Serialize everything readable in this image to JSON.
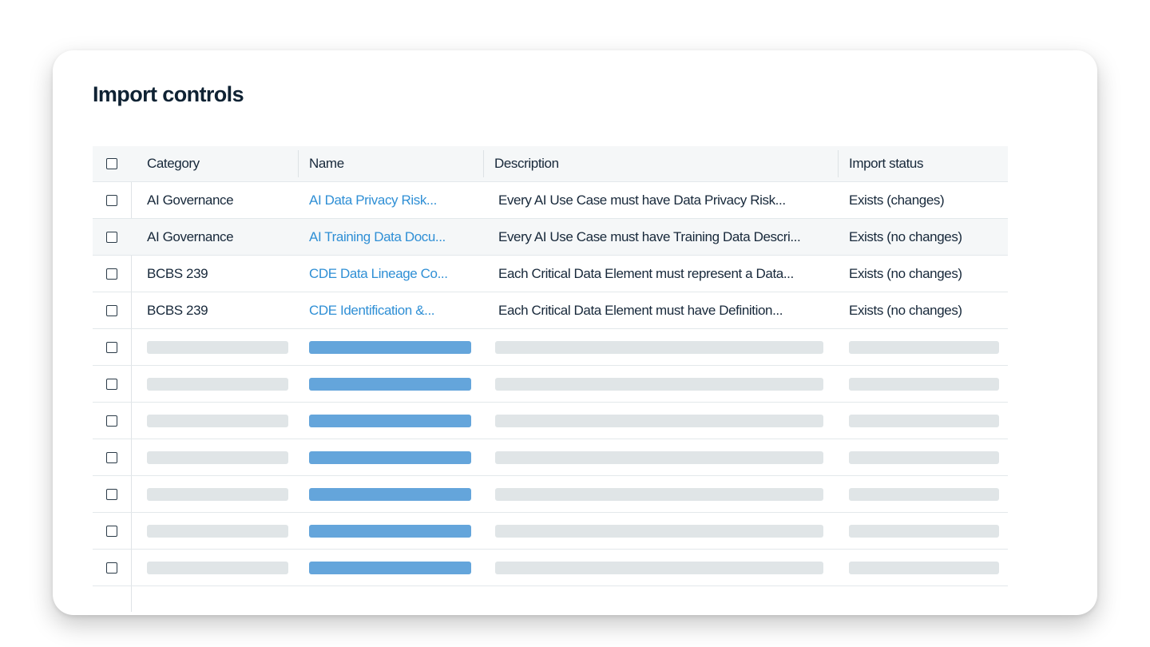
{
  "page": {
    "title": "Import controls"
  },
  "table": {
    "headers": {
      "category": "Category",
      "name": "Name",
      "description": "Description",
      "status": "Import status"
    },
    "rows": [
      {
        "category": "AI Governance",
        "name": "AI Data Privacy Risk...",
        "description": "Every AI Use Case must have Data Privacy Risk...",
        "status": "Exists (changes)"
      },
      {
        "category": "AI Governance",
        "name": "AI Training Data Docu...",
        "description": "Every AI Use Case must have Training Data Descri...",
        "status": "Exists (no changes)"
      },
      {
        "category": "BCBS 239",
        "name": "CDE Data Lineage Co...",
        "description": "Each Critical Data Element must represent a Data...",
        "status": "Exists (no changes)"
      },
      {
        "category": "BCBS 239",
        "name": "CDE Identification &...",
        "description": "Each Critical Data Element must have Definition...",
        "status": "Exists (no changes)"
      }
    ],
    "placeholder_row_count": 7
  },
  "colors": {
    "title": "#0f2233",
    "link": "#2f8fd5",
    "placeholder_gray": "#e0e5e7",
    "placeholder_blue": "#64a5db",
    "header_bg": "#f5f7f8"
  },
  "icons": {
    "checkbox": "checkbox-unchecked-icon"
  }
}
